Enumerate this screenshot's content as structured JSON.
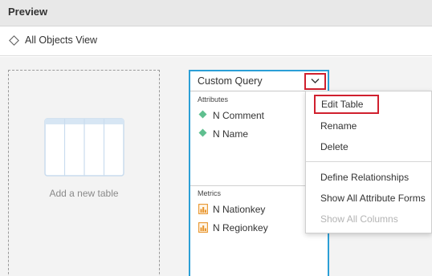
{
  "header": {
    "title": "Preview"
  },
  "viewbar": {
    "label": "All Objects View",
    "icon": "diamond-icon"
  },
  "add_table": {
    "label": "Add a new table",
    "icon": "table-placeholder-icon"
  },
  "query_card": {
    "title": "Custom Query",
    "attributes_label": "Attributes",
    "attributes": [
      {
        "label": "N Comment",
        "icon": "attribute-diamond-icon"
      },
      {
        "label": "N Name",
        "icon": "attribute-diamond-icon"
      }
    ],
    "metrics_label": "Metrics",
    "metrics": [
      {
        "label": "N Nationkey",
        "icon": "metric-icon"
      },
      {
        "label": "N Regionkey",
        "icon": "metric-icon"
      }
    ]
  },
  "menu": {
    "items": [
      {
        "label": "Edit Table",
        "highlighted": true,
        "enabled": true
      },
      {
        "label": "Rename",
        "enabled": true
      },
      {
        "label": "Delete",
        "enabled": true
      },
      {
        "label": "Define Relationships",
        "enabled": true
      },
      {
        "label": "Show All Attribute Forms",
        "enabled": true
      },
      {
        "label": "Show All Columns",
        "enabled": false
      }
    ]
  },
  "colors": {
    "accent_border": "#2b9fd6",
    "highlight_red": "#d0202e",
    "attribute_green": "#5fbf8f",
    "metric_orange": "#e8952c"
  }
}
